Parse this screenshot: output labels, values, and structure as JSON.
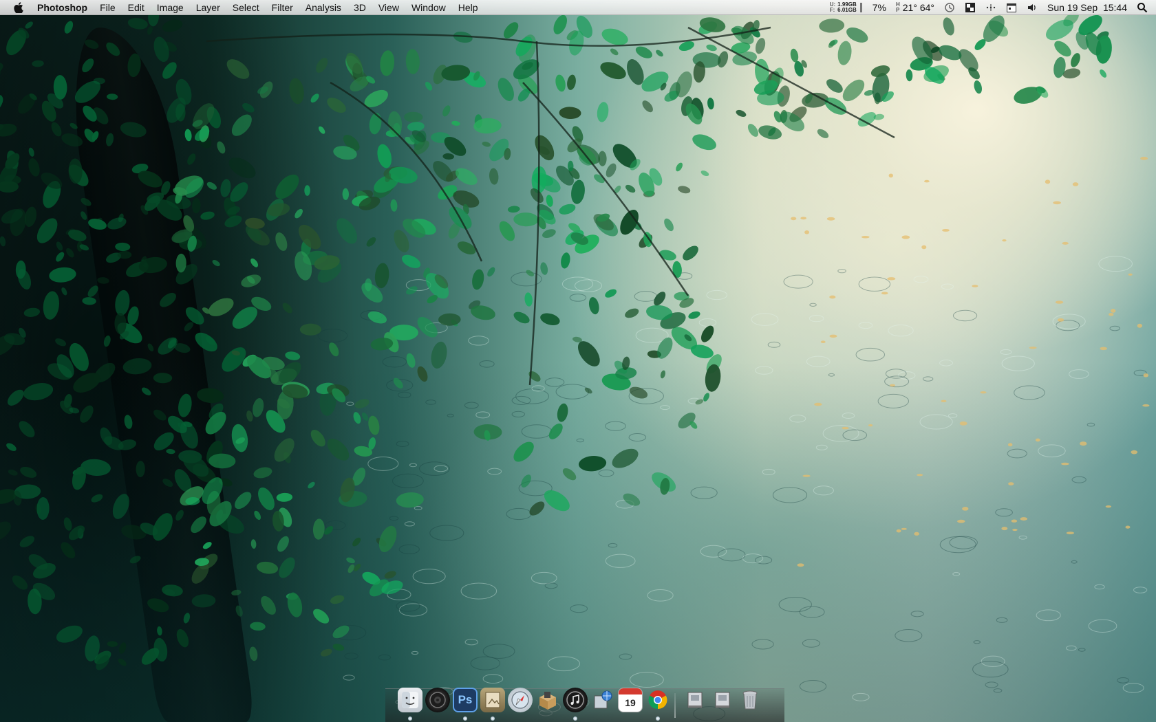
{
  "menubar": {
    "app_name": "Photoshop",
    "menus": [
      "File",
      "Edit",
      "Image",
      "Layer",
      "Select",
      "Filter",
      "Analysis",
      "3D",
      "View",
      "Window",
      "Help"
    ]
  },
  "status": {
    "memory": {
      "labels": [
        "U:",
        "F:"
      ],
      "values": [
        "1.99GB",
        "6.01GB"
      ]
    },
    "cpu": "7%",
    "weather_labels": [
      "H",
      "P"
    ],
    "weather": "21° 64°",
    "clock": "Sun 19 Sep  15:44"
  },
  "dock": {
    "apps": [
      "finder-icon",
      "speaker-icon",
      "photoshop-icon",
      "preview-icon",
      "safari-icon",
      "box-icon",
      "itunes-icon",
      "network-icon",
      "calendar-icon",
      "chrome-icon",
      "drive-icon",
      "drive-icon",
      "trash-icon"
    ],
    "photoshop_label": "Ps",
    "calendar_day": "19"
  },
  "colors": {
    "menubar": "#ececec",
    "photoshop": "#2a6fb8",
    "chrome_red": "#d93025",
    "chrome_yellow": "#f4b400",
    "chrome_green": "#0f9d58",
    "chrome_blue": "#4285f4"
  }
}
